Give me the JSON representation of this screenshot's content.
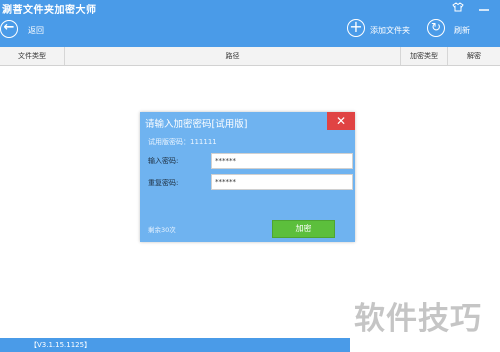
{
  "app": {
    "title": "涮菩文件夹加密大师",
    "skin_icon": "shirt-icon",
    "minimize_icon": "minimize-icon"
  },
  "toolbar": {
    "back_label": "返回",
    "add_folder_label": "添加文件夹",
    "refresh_label": "刷新"
  },
  "table": {
    "columns": [
      "文件类型",
      "路径",
      "加密类型",
      "解密"
    ]
  },
  "dialog": {
    "title": "请输入加密密码[试用版]",
    "trial_password": "试用版密码：111111",
    "password_label": "输入密码:",
    "password_value": "******",
    "confirm_label": "重复密码:",
    "confirm_value": "******",
    "remaining": "剩余30次",
    "encrypt_button": "加密",
    "close_glyph": "✕"
  },
  "statusbar": {
    "version": "【V3.1.15.1125】"
  },
  "watermark": "软件技巧",
  "colors": {
    "titlebar": "#4a9be8",
    "dialog": "#6fb3f0",
    "close": "#e04343",
    "encrypt_button": "#5cbf3c"
  }
}
